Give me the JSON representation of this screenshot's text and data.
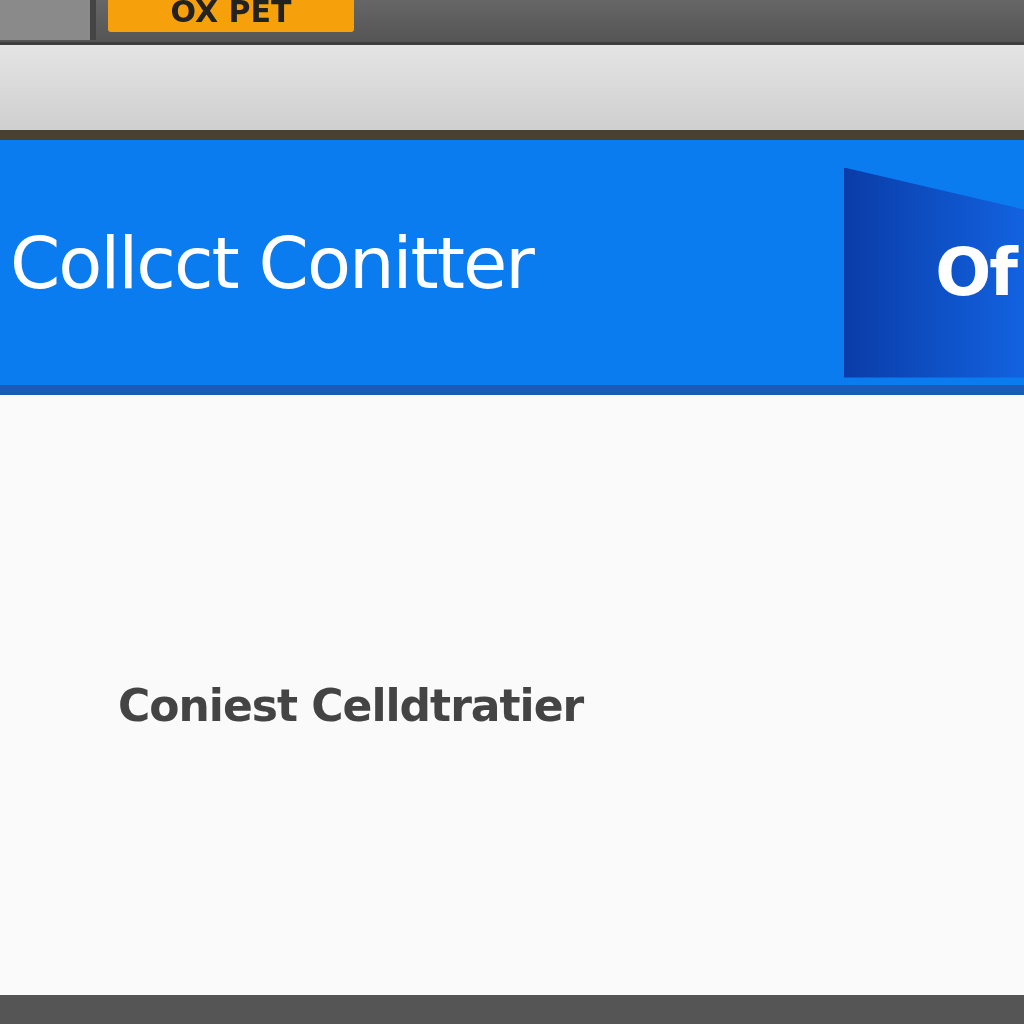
{
  "top_bar": {
    "tab": {
      "label": "OX PET",
      "selected": true
    }
  },
  "banner": {
    "title": "Collcct Conitter",
    "badge": "Of"
  },
  "content": {
    "text": "Coniest Celldtratier"
  }
}
